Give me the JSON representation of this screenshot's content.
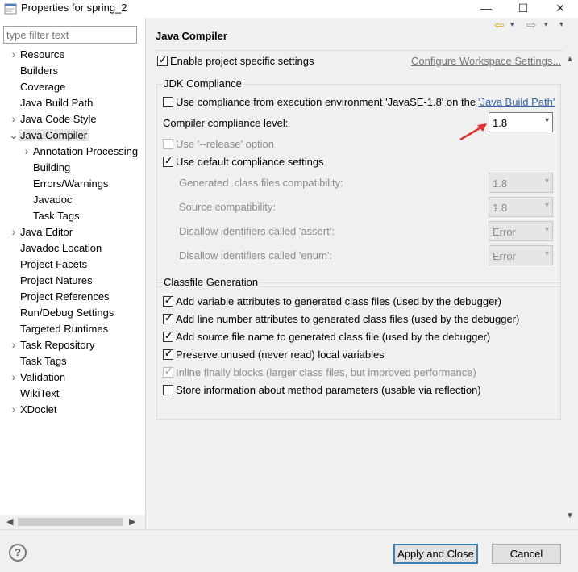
{
  "window": {
    "title": "Properties for spring_2",
    "minimize": "—",
    "maximize": "☐",
    "close": "✕"
  },
  "sidebar": {
    "filter_placeholder": "type filter text",
    "items": [
      {
        "label": "Resource",
        "expandable": true,
        "level": 0
      },
      {
        "label": "Builders",
        "expandable": false,
        "level": 0
      },
      {
        "label": "Coverage",
        "expandable": false,
        "level": 0
      },
      {
        "label": "Java Build Path",
        "expandable": false,
        "level": 0
      },
      {
        "label": "Java Code Style",
        "expandable": true,
        "level": 0
      },
      {
        "label": "Java Compiler",
        "expandable": true,
        "expanded": true,
        "selected": true,
        "level": 0
      },
      {
        "label": "Annotation Processing",
        "expandable": true,
        "level": 1
      },
      {
        "label": "Building",
        "expandable": false,
        "level": 1
      },
      {
        "label": "Errors/Warnings",
        "expandable": false,
        "level": 1
      },
      {
        "label": "Javadoc",
        "expandable": false,
        "level": 1
      },
      {
        "label": "Task Tags",
        "expandable": false,
        "level": 1
      },
      {
        "label": "Java Editor",
        "expandable": true,
        "level": 0
      },
      {
        "label": "Javadoc Location",
        "expandable": false,
        "level": 0
      },
      {
        "label": "Project Facets",
        "expandable": false,
        "level": 0
      },
      {
        "label": "Project Natures",
        "expandable": false,
        "level": 0
      },
      {
        "label": "Project References",
        "expandable": false,
        "level": 0
      },
      {
        "label": "Run/Debug Settings",
        "expandable": false,
        "level": 0
      },
      {
        "label": "Targeted Runtimes",
        "expandable": false,
        "level": 0
      },
      {
        "label": "Task Repository",
        "expandable": true,
        "level": 0
      },
      {
        "label": "Task Tags",
        "expandable": false,
        "level": 0
      },
      {
        "label": "Validation",
        "expandable": true,
        "level": 0
      },
      {
        "label": "WikiText",
        "expandable": false,
        "level": 0
      },
      {
        "label": "XDoclet",
        "expandable": true,
        "level": 0
      }
    ]
  },
  "main": {
    "title": "Java Compiler",
    "nav": {
      "back": "⇦",
      "back_menu": "▾",
      "forward": "⇨",
      "forward_menu": "▾",
      "view_menu": "▾"
    },
    "enable_project_specific": {
      "label": "Enable project specific settings",
      "checked": true
    },
    "configure_workspace_link": "Configure Workspace Settings...",
    "jdk_group": {
      "title": "JDK Compliance",
      "use_compliance_label": "Use compliance from execution environment 'JavaSE-1.8' on the ",
      "java_build_path_link": "'Java Build Path'",
      "compliance_level_label": "Compiler compliance level:",
      "compliance_level_value": "1.8",
      "release_option_label": "Use '--release' option",
      "use_default_label": "Use default compliance settings",
      "generated_label": "Generated .class files compatibility:",
      "generated_value": "1.8",
      "source_label": "Source compatibility:",
      "source_value": "1.8",
      "assert_label": "Disallow identifiers called 'assert':",
      "assert_value": "Error",
      "enum_label": "Disallow identifiers called 'enum':",
      "enum_value": "Error"
    },
    "classfile_group": {
      "title": "Classfile Generation",
      "options": [
        {
          "label": "Add variable attributes to generated class files (used by the debugger)",
          "checked": true,
          "disabled": false
        },
        {
          "label": "Add line number attributes to generated class files (used by the debugger)",
          "checked": true,
          "disabled": false
        },
        {
          "label": "Add source file name to generated class file (used by the debugger)",
          "checked": true,
          "disabled": false
        },
        {
          "label": "Preserve unused (never read) local variables",
          "checked": true,
          "disabled": false
        },
        {
          "label": "Inline finally blocks (larger class files, but improved performance)",
          "checked": true,
          "disabled": true
        },
        {
          "label": "Store information about method parameters (usable via reflection)",
          "checked": false,
          "disabled": false
        }
      ]
    }
  },
  "footer": {
    "help": "?",
    "apply_close": "Apply and Close",
    "cancel": "Cancel"
  },
  "colors": {
    "accent_link": "#3366aa",
    "primary_border": "#3c7fb1",
    "annotation_arrow": "#e03030"
  }
}
